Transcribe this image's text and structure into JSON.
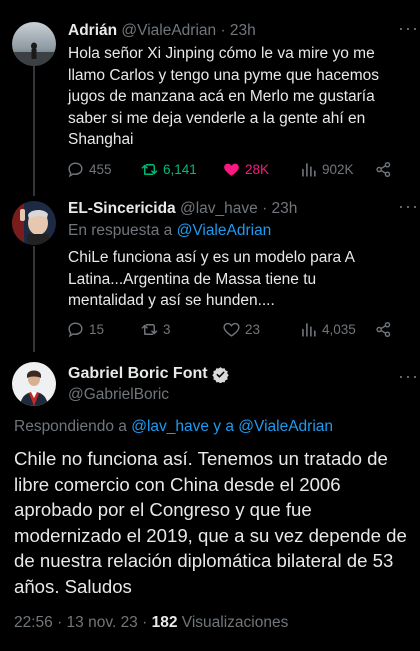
{
  "tweets": [
    {
      "name": "Adrián",
      "handle": "@VialeAdrian",
      "time": "· 23h",
      "text": "Hola señor Xi Jinping cómo le va mire yo me llamo Carlos y tengo una pyme que hacemos jugos de manzana acá en Merlo me gustaría saber si me deja venderle a la gente ahí en Shanghai",
      "replies": "455",
      "retweets": "6,141",
      "likes": "28K",
      "views": "902K"
    },
    {
      "name": "EL-Sincericida",
      "handle": "@lav_have",
      "time": "· 23h",
      "reply_prefix": "En respuesta a ",
      "reply_target": "@VialeAdrian",
      "text": "ChiLe funciona así y es un modelo para A Latina...Argentina de Massa tiene tu mentalidad y así se hunden....",
      "replies": "15",
      "retweets": "3",
      "likes": "23",
      "views": "4,035"
    }
  ],
  "main_tweet": {
    "name": "Gabriel Boric Font",
    "handle": "@GabrielBoric",
    "reply_prefix": "Respondiendo a ",
    "reply_target": "@lav_have y a @VialeAdrian",
    "text": "Chile no funciona así. Tenemos un tratado de libre comercio con China desde el 2006 aprobado por el Congreso y que fue modernizado el 2019, que a su vez depende de de nuestra relación diplomática bilateral de 53 años. Saludos",
    "time": "22:56 · 13 nov. 23 · ",
    "views_count": "182",
    "views_label": " Visualizaciones"
  },
  "icons": [
    "reply-icon",
    "retweet-icon",
    "like-icon",
    "views-icon",
    "share-icon",
    "more-icon",
    "verified-icon"
  ],
  "colors": {
    "background": "#000000",
    "text": "#e7e9ea",
    "secondary": "#71767b",
    "link": "#1d9bf0",
    "retweet": "#00ba7c",
    "like": "#f91880"
  }
}
